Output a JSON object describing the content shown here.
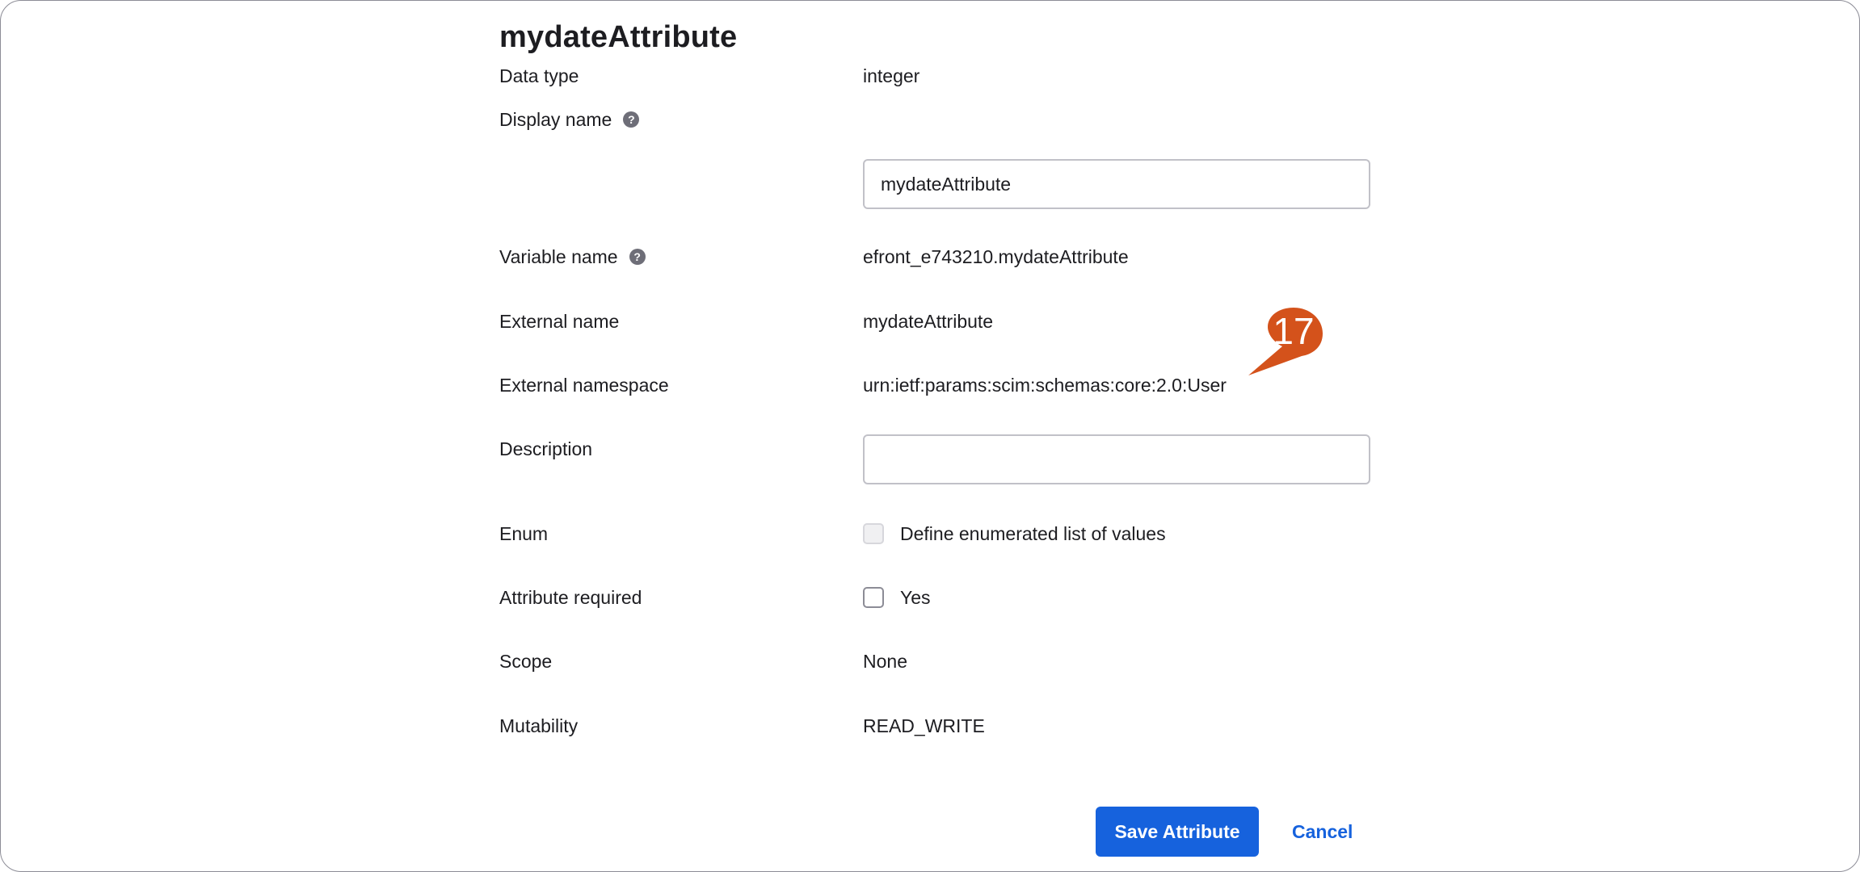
{
  "title": "mydateAttribute",
  "fields": {
    "data_type": {
      "label": "Data type",
      "value": "integer"
    },
    "display_name": {
      "label": "Display name",
      "value": "mydateAttribute"
    },
    "variable_name": {
      "label": "Variable name",
      "value": "efront_e743210.mydateAttribute"
    },
    "external_name": {
      "label": "External name",
      "value": "mydateAttribute"
    },
    "external_namespace": {
      "label": "External namespace",
      "value": "urn:ietf:params:scim:schemas:core:2.0:User"
    },
    "description": {
      "label": "Description",
      "value": ""
    },
    "enum": {
      "label": "Enum",
      "checkbox_label": "Define enumerated list of values",
      "checked": false,
      "disabled": true
    },
    "attribute_required": {
      "label": "Attribute required",
      "checkbox_label": "Yes",
      "checked": false
    },
    "scope": {
      "label": "Scope",
      "value": "None"
    },
    "mutability": {
      "label": "Mutability",
      "value": "READ_WRITE"
    }
  },
  "help_icon_glyph": "?",
  "actions": {
    "save_label": "Save Attribute",
    "cancel_label": "Cancel"
  },
  "callout": {
    "number": "17",
    "color": "#d4521b"
  },
  "colors": {
    "primary": "#1662dd",
    "text": "#1d1d21",
    "border": "#c1c1c8"
  }
}
